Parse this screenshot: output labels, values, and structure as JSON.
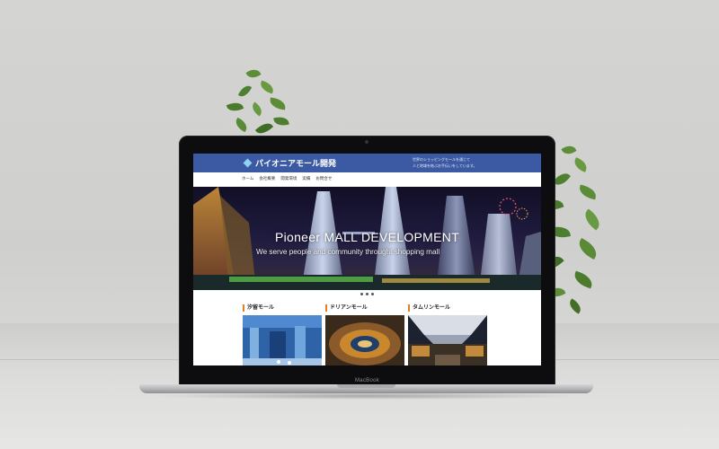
{
  "laptop": {
    "brand_label": "MacBook"
  },
  "site": {
    "logo_text": "パイオニアモール開発",
    "tagline_line1": "世界のショッピングモールを通じて",
    "tagline_line2": "人と地域を結ぶお手伝いをしています。",
    "nav": [
      "ホーム",
      "会社概要",
      "開発環境",
      "実績",
      "お問合せ"
    ],
    "hero_title": "Pioneer MALL DEVELOPMENT",
    "hero_subtitle": "We serve people and community throught shopping mall",
    "carousel_dots": 3,
    "cards": [
      {
        "title": "汐留モール"
      },
      {
        "title": "ドリアンモール"
      },
      {
        "title": "タムリンモール"
      }
    ],
    "colors": {
      "header": "#3b5aa3",
      "card_accent": "#e47d1f"
    }
  },
  "icons": {
    "logo": "diamond-logo-icon",
    "camera": "camera-icon"
  }
}
